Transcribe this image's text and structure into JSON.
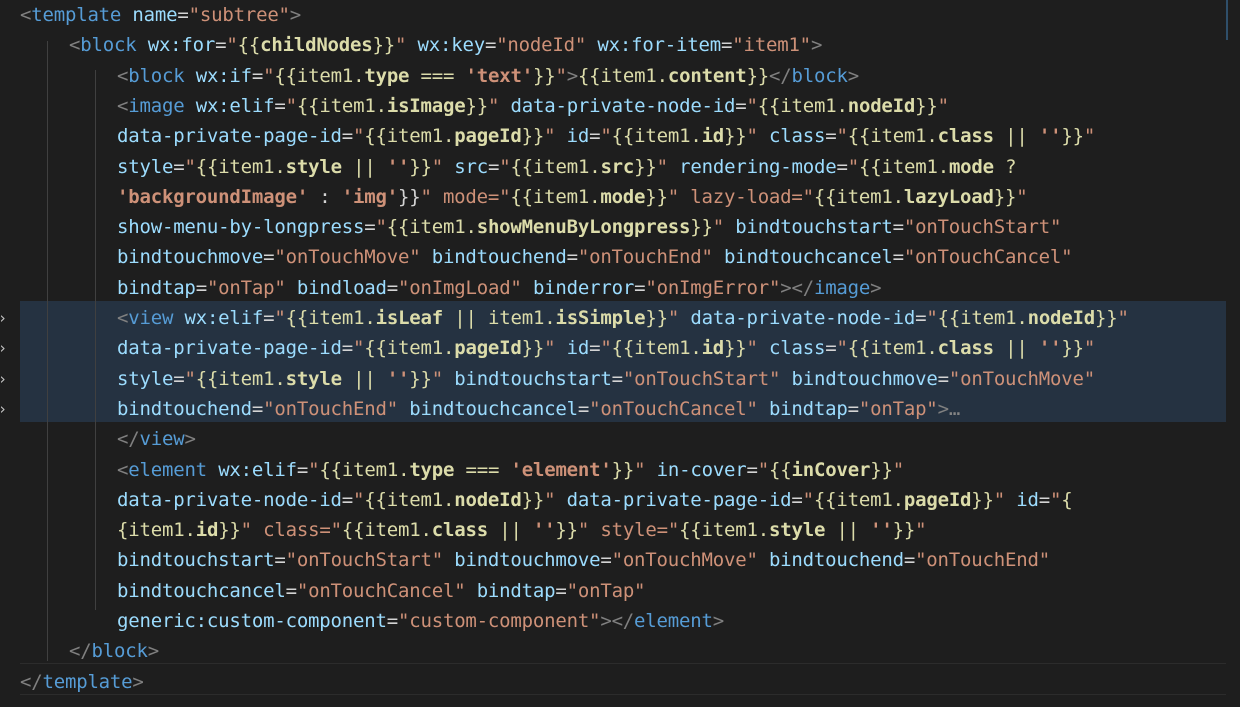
{
  "editor": {
    "language": "wxml",
    "folded_line_indicator": "…",
    "lines": [
      "<template name=\"subtree\">",
      "<block wx:for=\"{{childNodes}}\" wx:key=\"nodeId\" wx:for-item=\"item1\">",
      "<block wx:if=\"{{item1.type === 'text'}}\">{{item1.content}}</block>",
      "<image wx:elif=\"{{item1.isImage}}\" data-private-node-id=\"{{item1.nodeId}}\"",
      "data-private-page-id=\"{{item1.pageId}}\" id=\"{{item1.id}}\" class=\"{{item1.class || ''}}\"",
      "style=\"{{item1.style || ''}}\" src=\"{{item1.src}}\" rendering-mode=\"{{item1.mode ?",
      "'backgroundImage' : 'img'}}\" mode=\"{{item1.mode}}\" lazy-load=\"{{item1.lazyLoad}}\"",
      "show-menu-by-longpress=\"{{item1.showMenuByLongpress}}\" bindtouchstart=\"onTouchStart\"",
      "bindtouchmove=\"onTouchMove\" bindtouchend=\"onTouchEnd\" bindtouchcancel=\"onTouchCancel\"",
      "bindtap=\"onTap\" bindload=\"onImgLoad\" binderror=\"onImgError\"></image>",
      "<view wx:elif=\"{{item1.isLeaf || item1.isSimple}}\" data-private-node-id=\"{{item1.nodeId}}\"",
      "data-private-page-id=\"{{item1.pageId}}\" id=\"{{item1.id}}\" class=\"{{item1.class || ''}}\"",
      "style=\"{{item1.style || ''}}\" bindtouchstart=\"onTouchStart\" bindtouchmove=\"onTouchMove\"",
      "bindtouchend=\"onTouchEnd\" bindtouchcancel=\"onTouchCancel\" bindtap=\"onTap\">…",
      "</view>",
      "<element wx:elif=\"{{item1.type === 'element'}}\" in-cover=\"{{inCover}}\"",
      "data-private-node-id=\"{{item1.nodeId}}\" data-private-page-id=\"{{item1.pageId}}\" id=\"{",
      "{item1.id}}\" class=\"{{item1.class || ''}}\" style=\"{{item1.style || ''}}\"",
      "bindtouchstart=\"onTouchStart\" bindtouchmove=\"onTouchMove\" bindtouchend=\"onTouchEnd\"",
      "bindtouchcancel=\"onTouchCancel\" bindtap=\"onTap\"",
      "generic:custom-component=\"custom-component\"></element>",
      "</block>",
      "</template>"
    ]
  },
  "colors": {
    "background": "#1e1e1e",
    "tag": "#569cd6",
    "attribute": "#9cdcfe",
    "string": "#ce9178",
    "expression": "#dcdcaa",
    "punctuation": "#808080",
    "selection": "#253241"
  }
}
